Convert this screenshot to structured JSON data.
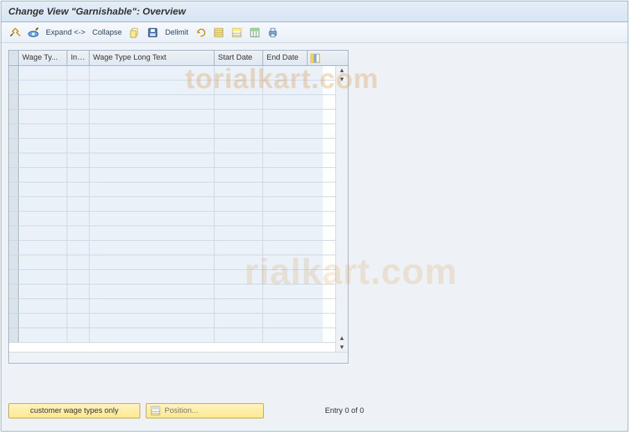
{
  "title": "Change View \"Garnishable\": Overview",
  "toolbar": {
    "expand": "Expand <->",
    "collapse": "Collapse",
    "delimit": "Delimit"
  },
  "table": {
    "columns": {
      "wage_type": "Wage Ty...",
      "inf": "Inf...",
      "long_text": "Wage Type Long Text",
      "start_date": "Start Date",
      "end_date": "End Date"
    },
    "rows": [
      {},
      {},
      {},
      {},
      {},
      {},
      {},
      {},
      {},
      {},
      {},
      {},
      {},
      {},
      {},
      {},
      {},
      {},
      {}
    ]
  },
  "footer": {
    "customer_only": "customer wage types only",
    "position": "Position...",
    "entry_status": "Entry 0 of 0"
  },
  "watermark": {
    "t1": "torialkart.com",
    "t2": "rialkart.com"
  }
}
